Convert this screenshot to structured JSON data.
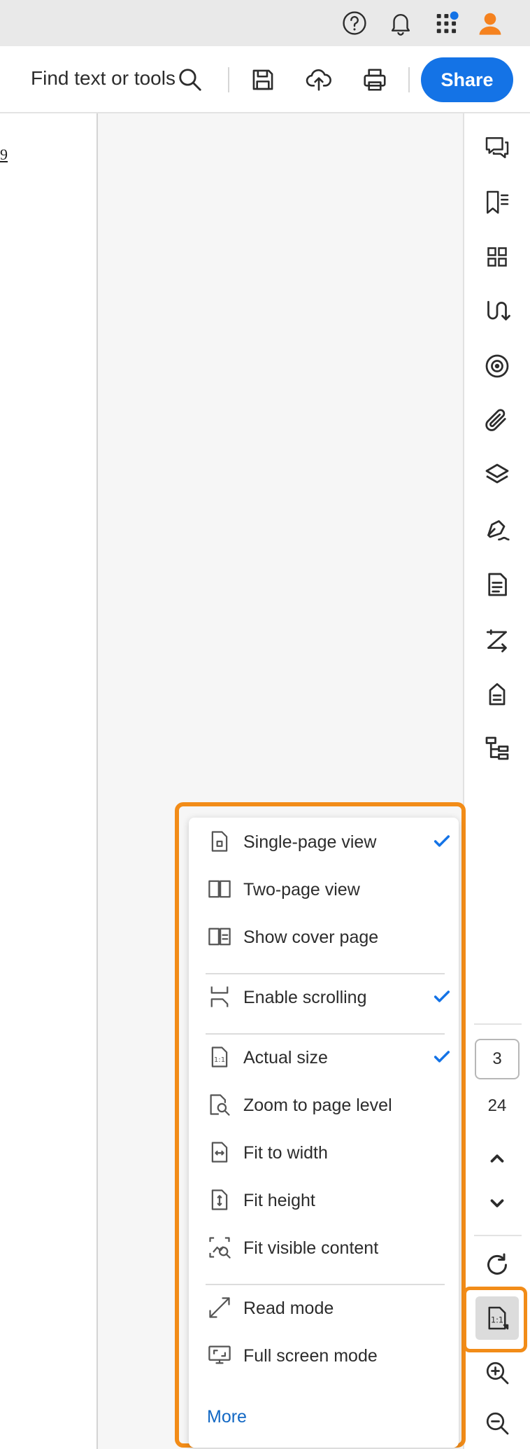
{
  "system_bar": {
    "icons": [
      "help-icon",
      "bell-icon",
      "apps-icon",
      "avatar-icon"
    ],
    "colors": {
      "background": "#e9e9e9",
      "notification_dot": "#1473e6",
      "avatar": "#f5821f"
    }
  },
  "toolbar": {
    "find_label": "Find text or tools",
    "share_label": "Share",
    "icons": [
      "search-icon",
      "save-icon",
      "cloud-upload-icon",
      "print-icon"
    ],
    "colors": {
      "share_background": "#1473e6"
    }
  },
  "document": {
    "page_fragment": "9"
  },
  "right_rail": {
    "icons": [
      "comment-icon",
      "bookmark-icon",
      "thumbnails-icon",
      "organize-icon",
      "target-icon",
      "attachment-icon",
      "layers-icon",
      "sign-icon",
      "document-icon",
      "redact-icon",
      "tag-icon",
      "tree-icon",
      "rotate-icon",
      "page-view-icon",
      "zoom-in-icon",
      "zoom-out-icon"
    ],
    "current_page": "3",
    "total_pages": "24"
  },
  "view_menu": {
    "items": [
      {
        "label": "Single-page view",
        "icon": "single-page-icon",
        "checked": true
      },
      {
        "label": "Two-page view",
        "icon": "two-page-icon",
        "checked": false
      },
      {
        "label": "Show cover page",
        "icon": "cover-page-icon",
        "checked": false
      },
      {
        "label": "Enable scrolling",
        "icon": "scrolling-icon",
        "checked": true
      },
      {
        "label": "Actual size",
        "icon": "actual-size-icon",
        "checked": true
      },
      {
        "label": "Zoom to page level",
        "icon": "zoom-page-icon",
        "checked": false
      },
      {
        "label": "Fit to width",
        "icon": "fit-width-icon",
        "checked": false
      },
      {
        "label": "Fit height",
        "icon": "fit-height-icon",
        "checked": false
      },
      {
        "label": "Fit visible content",
        "icon": "fit-content-icon",
        "checked": false
      },
      {
        "label": "Read mode",
        "icon": "read-mode-icon",
        "checked": false
      },
      {
        "label": "Full screen mode",
        "icon": "full-screen-icon",
        "checked": false
      }
    ],
    "more_label": "More",
    "colors": {
      "highlight": "#f28c18",
      "check": "#1473e6",
      "more_link": "#1268c4"
    }
  }
}
